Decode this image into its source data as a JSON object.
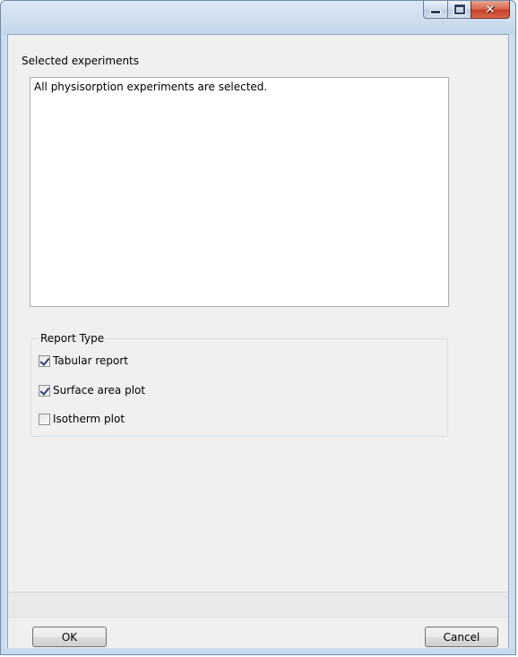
{
  "window": {
    "title": "",
    "caption_buttons": [
      "minimize-icon",
      "maximize-icon",
      "close-icon"
    ],
    "close_glyph": "✕"
  },
  "experiments": {
    "label": "Selected experiments",
    "text": "All physisorption experiments are selected."
  },
  "report_type": {
    "legend": "Report Type",
    "options": [
      {
        "label": "Tabular report",
        "checked": true
      },
      {
        "label": "Surface area plot",
        "checked": true
      },
      {
        "label": "Isotherm plot",
        "checked": false
      }
    ]
  },
  "buttons": {
    "ok": "OK",
    "cancel": "Cancel"
  },
  "colors": {
    "frame": "#c9daec",
    "close_button": "#c7412a",
    "client_bg": "#f0f0f0"
  }
}
